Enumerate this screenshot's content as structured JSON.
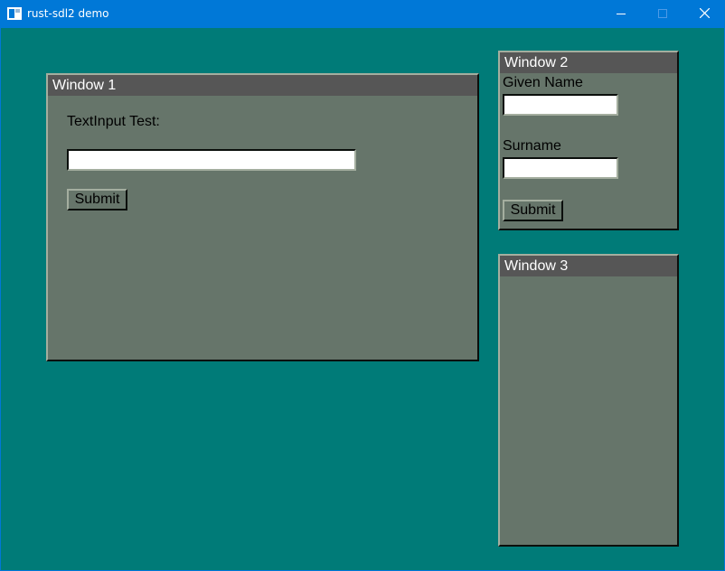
{
  "titlebar": {
    "title": "rust-sdl2 demo",
    "app_icon": "window-app-icon",
    "minimize_icon": "minimize-icon",
    "maximize_icon": "maximize-icon",
    "close_icon": "close-icon"
  },
  "colors": {
    "titlebar": "#0078d7",
    "desktop": "#007b78",
    "panel": "#66756a",
    "panel_title_bar": "#565656",
    "input_background": "#ffffff"
  },
  "window1": {
    "title": "Window 1",
    "label": "TextInput Test:",
    "input_value": "",
    "submit_label": "Submit"
  },
  "window2": {
    "title": "Window 2",
    "given_name_label": "Given Name",
    "given_name_value": "",
    "surname_label": "Surname",
    "surname_value": "",
    "submit_label": "Submit"
  },
  "window3": {
    "title": "Window 3"
  }
}
